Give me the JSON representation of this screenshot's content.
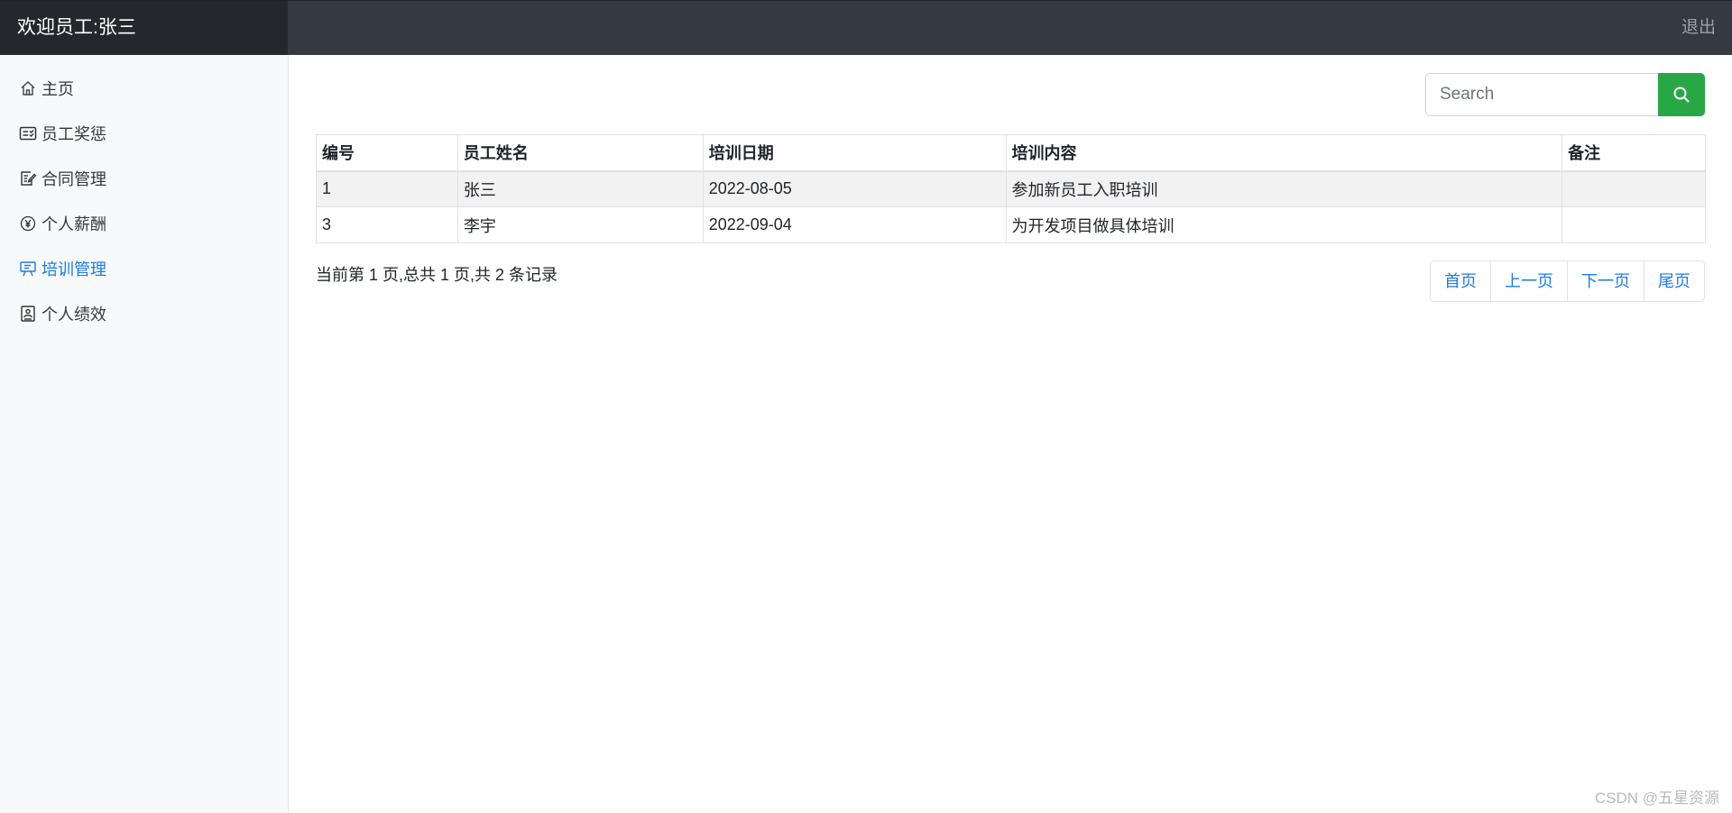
{
  "header": {
    "brand": "欢迎员工:张三",
    "logout": "退出"
  },
  "sidebar": {
    "items": [
      {
        "label": "主页",
        "icon": "house-icon",
        "active": false
      },
      {
        "label": "员工奖惩",
        "icon": "checklist-card-icon",
        "active": false
      },
      {
        "label": "合同管理",
        "icon": "edit-document-icon",
        "active": false
      },
      {
        "label": "个人薪酬",
        "icon": "yen-coin-icon",
        "active": false
      },
      {
        "label": "培训管理",
        "icon": "presentation-board-icon",
        "active": true
      },
      {
        "label": "个人绩效",
        "icon": "person-badge-icon",
        "active": false
      }
    ]
  },
  "search": {
    "placeholder": "Search",
    "button_icon": "search-icon"
  },
  "table": {
    "headers": [
      "编号",
      "员工姓名",
      "培训日期",
      "培训内容",
      "备注"
    ],
    "rows": [
      [
        "1",
        "张三",
        "2022-08-05",
        "参加新员工入职培训",
        ""
      ],
      [
        "3",
        "李宇",
        "2022-09-04",
        "为开发项目做具体培训",
        ""
      ]
    ]
  },
  "summary": "当前第 1 页,总共 1 页,共 2 条记录",
  "pagination": {
    "first": "首页",
    "prev": "上一页",
    "next": "下一页",
    "last": "尾页"
  },
  "watermark": "CSDN @五星资源",
  "colors": {
    "accent": "#1a7bea",
    "search_button": "#28a745",
    "navbar": "#343a40",
    "brand_bg": "#24282c"
  }
}
